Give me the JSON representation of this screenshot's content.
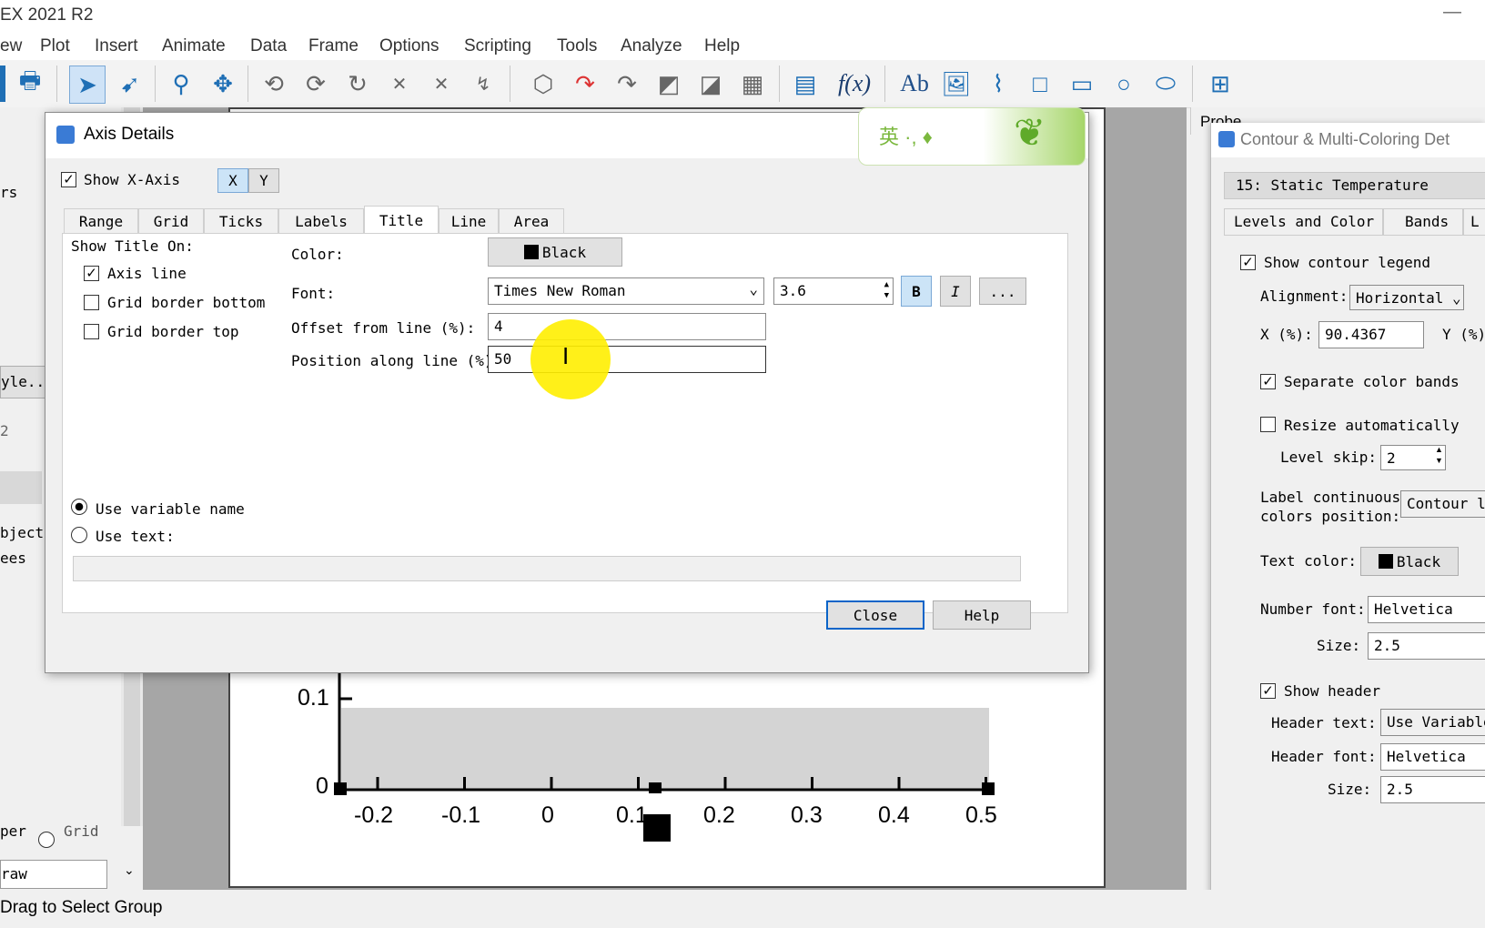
{
  "app": {
    "title": "EX 2021 R2"
  },
  "menu": [
    "ew",
    "Plot",
    "Insert",
    "Animate",
    "Data",
    "Frame",
    "Options",
    "Scripting",
    "Tools",
    "Analyze",
    "Help"
  ],
  "left_panel": {
    "labels": [
      "rs",
      "yle...",
      "2",
      "bjects",
      "ees",
      "per",
      "Grid",
      "raw"
    ]
  },
  "status": {
    "text": "Drag to Select Group"
  },
  "ime": {
    "chars": "英 ·, ♦"
  },
  "dialog": {
    "title": "Axis Details",
    "show_x_axis": "Show X-Axis",
    "axis_x": "X",
    "axis_y": "Y",
    "tabs": [
      "Range",
      "Grid",
      "Ticks",
      "Labels",
      "Title",
      "Line",
      "Area"
    ],
    "show_title_on": "Show Title On:",
    "axis_line": "Axis line",
    "grid_border_bottom": "Grid border bottom",
    "grid_border_top": "Grid border top",
    "color_label": "Color:",
    "color_value": "Black",
    "font_label": "Font:",
    "font_value": "Times New Roman",
    "font_size": "3.6",
    "bold": "B",
    "italic": "I",
    "more": "...",
    "offset_label": "Offset from line (%):",
    "offset_value": "4",
    "position_label": "Position along line (%):",
    "position_value": "50",
    "use_variable_name": "Use variable name",
    "use_text": "Use text:",
    "text_value": "",
    "close": "Close",
    "help": "Help"
  },
  "plot": {
    "y_ticks": [
      "0.1",
      "0"
    ],
    "x_ticks": [
      "-0.2",
      "-0.1",
      "0",
      "0.1",
      "0.2",
      "0.3",
      "0.4",
      "0.5"
    ]
  },
  "probe": {
    "label": "Probe"
  },
  "contour": {
    "title": "Contour & Multi-Coloring Det",
    "variable": "15: Static Temperature",
    "tabs": [
      "Levels and Color",
      "Bands",
      "L"
    ],
    "show_legend": "Show contour legend",
    "alignment_label": "Alignment:",
    "alignment_value": "Horizontal",
    "x_label": "X (%):",
    "x_value": "90.4367",
    "y_label": "Y (%)",
    "separate_bands": "Separate color bands",
    "resize_auto": "Resize automatically",
    "level_skip_label": "Level skip:",
    "level_skip_value": "2",
    "label_continuous": "Label continuous",
    "colors_position": "colors position:",
    "colors_position_value": "Contour le",
    "text_color_label": "Text color:",
    "text_color_value": "Black",
    "number_font_label": "Number font:",
    "number_font_value": "Helvetica",
    "size_label": "Size:",
    "size_value": "2.5",
    "show_header": "Show header",
    "header_text_label": "Header text:",
    "header_text_value": "Use Variable",
    "header_font_label": "Header font:",
    "header_font_value": "Helvetica",
    "header_size_label": "Size:",
    "header_size_value": "2.5"
  }
}
